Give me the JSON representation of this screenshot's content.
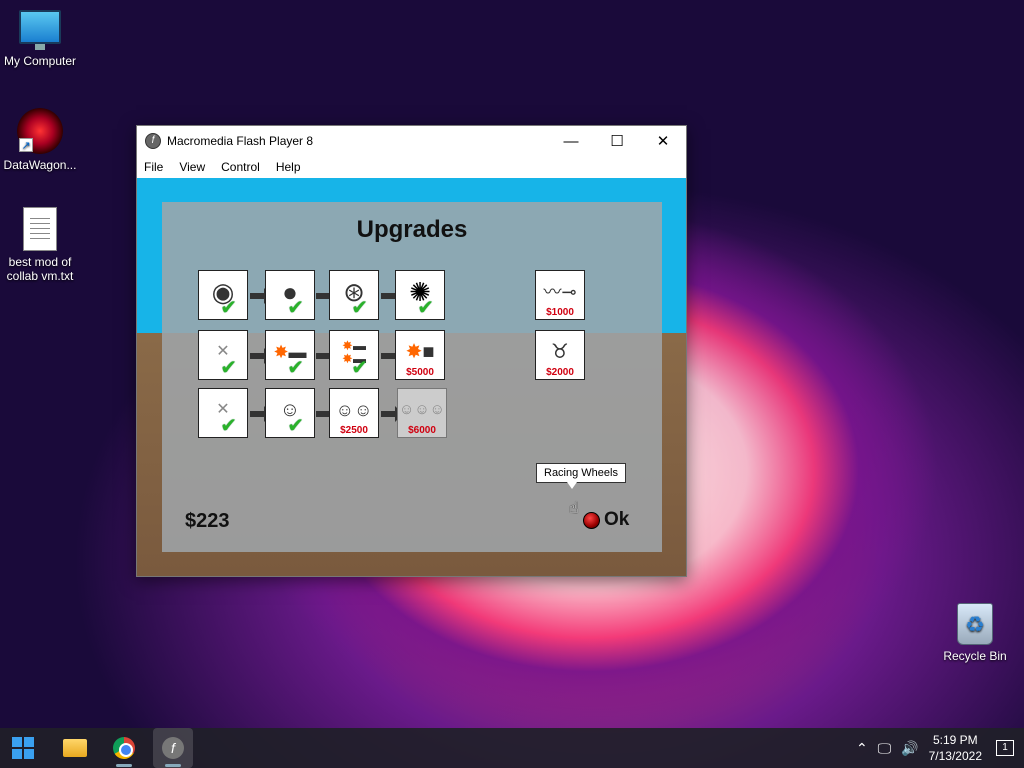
{
  "desktop": {
    "icons": [
      {
        "label": "My Computer",
        "icon": "monitor-icon"
      },
      {
        "label": "DataWagon...",
        "icon": "sunburst-app-icon"
      },
      {
        "label": "best mod of collab vm.txt",
        "icon": "text-file-icon"
      },
      {
        "label": "Recycle Bin",
        "icon": "recycle-bin-icon"
      }
    ]
  },
  "window": {
    "title": "Macromedia Flash Player 8",
    "controls": {
      "minimize": "—",
      "maximize": "☐",
      "close": "✕"
    },
    "menu": [
      "File",
      "View",
      "Control",
      "Help"
    ]
  },
  "game": {
    "title": "Upgrades",
    "money": "$223",
    "tooltip": "Racing Wheels",
    "ok_label": "Ok",
    "rows": [
      [
        {
          "icon": "wheel-basic-icon",
          "owned": true,
          "price": ""
        },
        {
          "icon": "wheel-round-icon",
          "owned": true,
          "price": ""
        },
        {
          "icon": "wheel-spoked-icon",
          "owned": true,
          "price": ""
        },
        {
          "icon": "wheel-racing-icon",
          "owned": true,
          "price": ""
        }
      ],
      [
        {
          "icon": "none-icon",
          "owned": true,
          "price": ""
        },
        {
          "icon": "rocket-small-icon",
          "owned": true,
          "price": ""
        },
        {
          "icon": "rocket-double-icon",
          "owned": true,
          "price": ""
        },
        {
          "icon": "rocket-large-icon",
          "owned": false,
          "price": "$5000"
        }
      ],
      [
        {
          "icon": "none-icon",
          "owned": true,
          "price": ""
        },
        {
          "icon": "one-person-icon",
          "owned": true,
          "price": ""
        },
        {
          "icon": "two-people-icon",
          "owned": false,
          "price": "$2500"
        },
        {
          "icon": "three-people-icon",
          "owned": false,
          "locked": true,
          "price": "$6000"
        }
      ]
    ],
    "extras": [
      {
        "icon": "spring-launcher-icon",
        "price": "$1000"
      },
      {
        "icon": "robot-helper-icon",
        "price": "$2000"
      }
    ]
  },
  "taskbar": {
    "items": [
      "start-icon",
      "file-explorer-icon",
      "chrome-icon",
      "flash-player-icon"
    ],
    "time": "5:19 PM",
    "date": "7/13/2022",
    "notification_count": "1"
  }
}
